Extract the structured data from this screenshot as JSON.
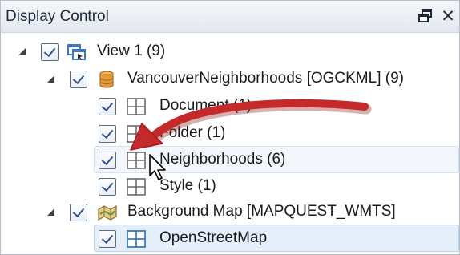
{
  "panel": {
    "title": "Display Control",
    "close_glyph": "✕",
    "restore_icon": "restore-window-icon"
  },
  "tree": {
    "items": [
      {
        "label": "View 1 (9)",
        "icon": "view-icon",
        "checked": true,
        "expanded": true
      },
      {
        "label": "VancouverNeighborhoods [OGCKML] (9)",
        "icon": "database-icon",
        "checked": true,
        "expanded": true
      },
      {
        "label": "Document (1)",
        "icon": "table-grid-icon",
        "checked": true
      },
      {
        "label": "Folder (1)",
        "icon": "table-grid-icon",
        "checked": true
      },
      {
        "label": "Neighborhoods (6)",
        "icon": "table-grid-icon",
        "checked": true,
        "state": "hover"
      },
      {
        "label": "Style (1)",
        "icon": "table-grid-icon",
        "checked": true
      },
      {
        "label": "Background Map [MAPQUEST_WMTS]",
        "icon": "map-icon",
        "checked": true,
        "expanded": true
      },
      {
        "label": "OpenStreetMap",
        "icon": "table-grid-blue-icon",
        "checked": true,
        "state": "selected"
      }
    ]
  },
  "annotation": {
    "arrow_color": "#c42a2a",
    "arrow_icon": "red-arrow-icon",
    "cursor_icon": "mouse-pointer-icon"
  }
}
